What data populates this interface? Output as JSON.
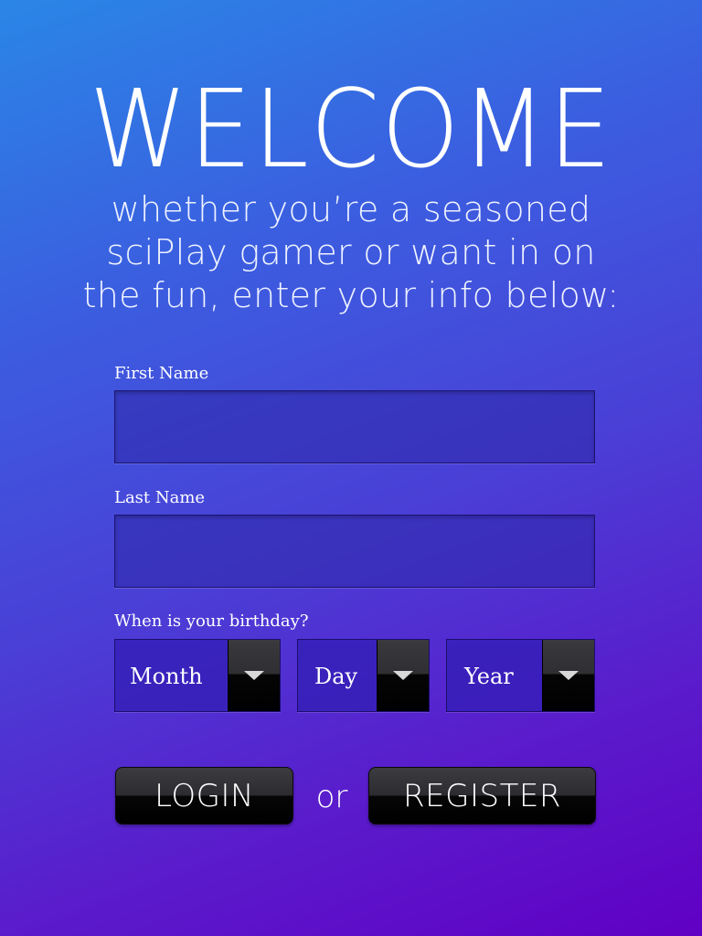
{
  "header": {
    "title": "WELCOME",
    "subtitle": "whether you’re a seasoned sciPlay gamer or want in on the fun, enter your info below:"
  },
  "form": {
    "first_name": {
      "label": "First Name",
      "value": ""
    },
    "last_name": {
      "label": "Last Name",
      "value": ""
    },
    "birthday": {
      "label": "When is your birthday?",
      "month": "Month",
      "day": "Day",
      "year": "Year"
    }
  },
  "actions": {
    "login_label": "LOGIN",
    "or_label": "or",
    "register_label": "REGISTER"
  },
  "colors": {
    "background_top": "#2a86e6",
    "background_bottom": "#6000c4",
    "field_bg": "#3a2fb0",
    "button_bg": "#1a1a1e"
  },
  "icons": {
    "dropdown": "caret-down-icon"
  }
}
